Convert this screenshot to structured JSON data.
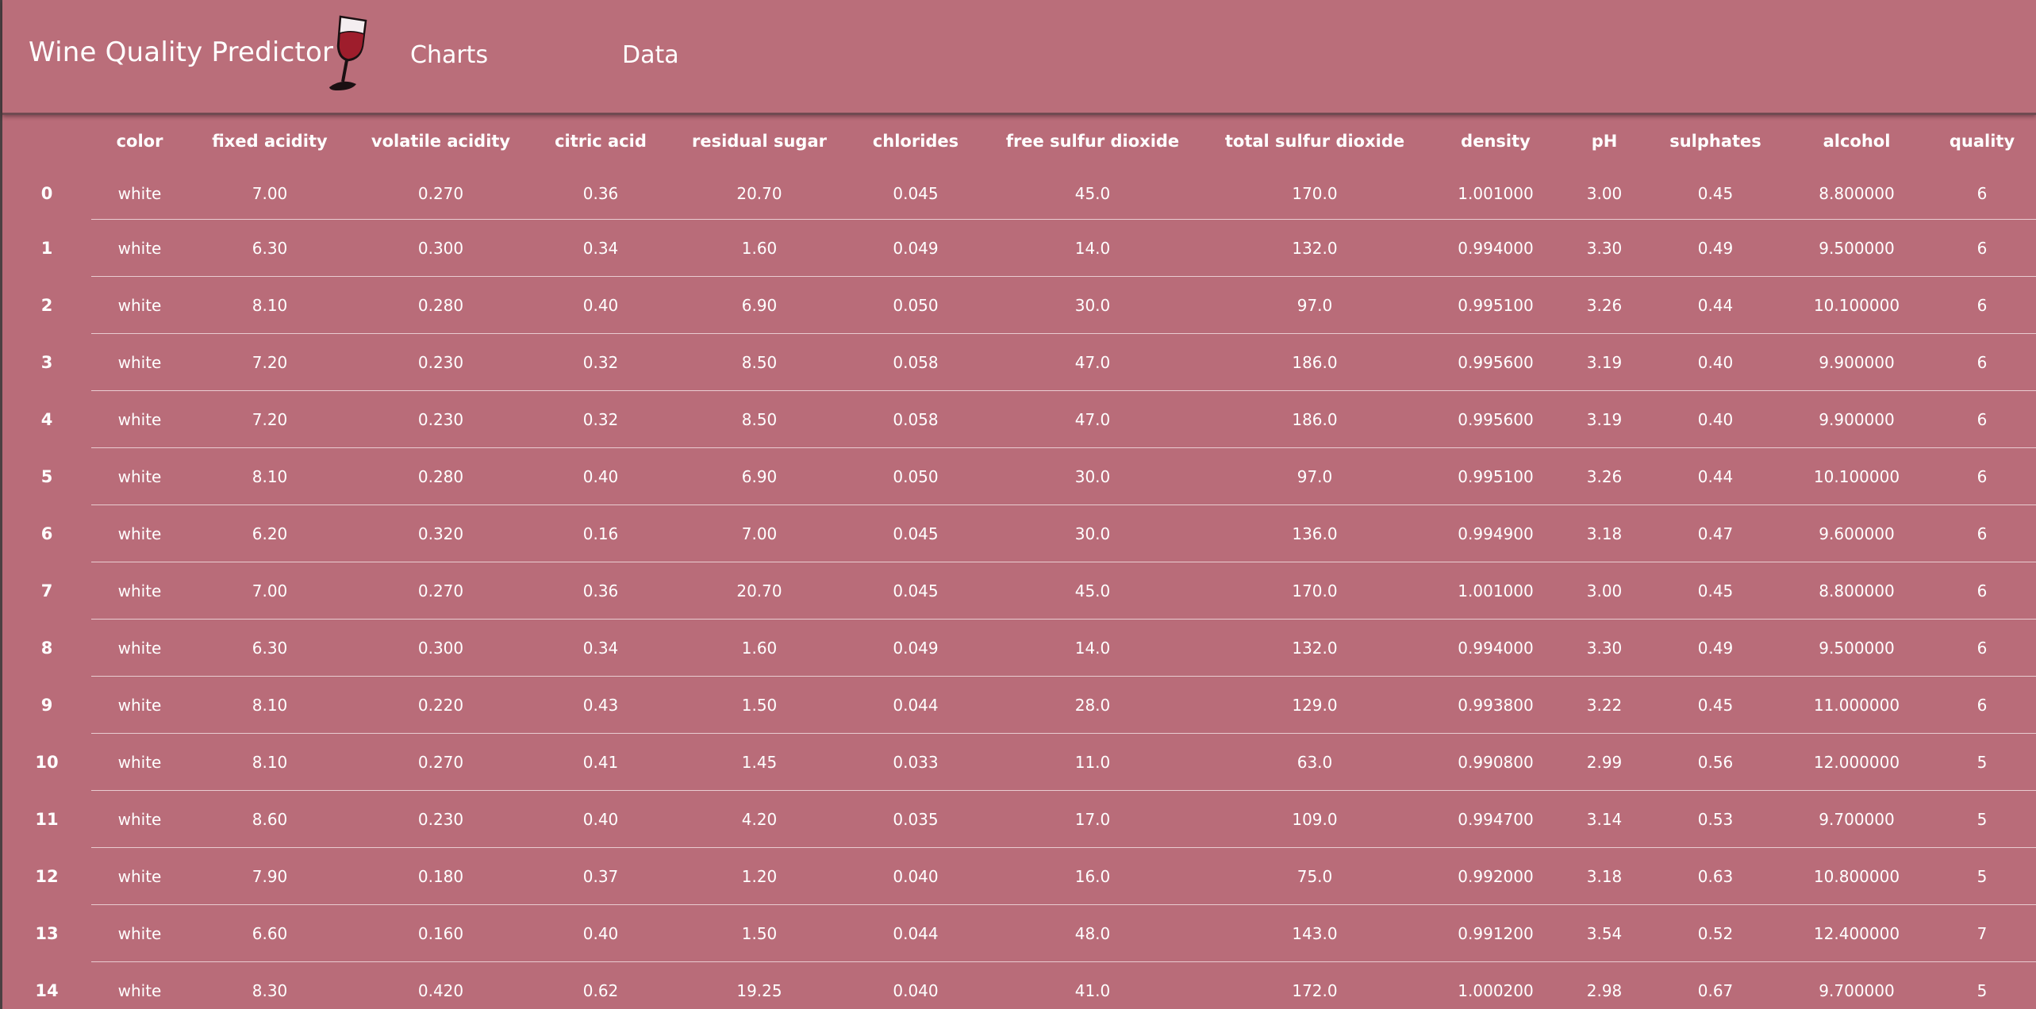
{
  "app": {
    "title": "Wine Quality Predictor",
    "nav": [
      {
        "label": "Charts"
      },
      {
        "label": "Data"
      }
    ],
    "accent_bg": "#b96c79",
    "wine_color": "#9e1d2c"
  },
  "table": {
    "columns": [
      "color",
      "fixed acidity",
      "volatile acidity",
      "citric acid",
      "residual sugar",
      "chlorides",
      "free sulfur dioxide",
      "total sulfur dioxide",
      "density",
      "pH",
      "sulphates",
      "alcohol",
      "quality"
    ],
    "rows": [
      [
        "0",
        "white",
        "7.00",
        "0.270",
        "0.36",
        "20.70",
        "0.045",
        "45.0",
        "170.0",
        "1.001000",
        "3.00",
        "0.45",
        "8.800000",
        "6"
      ],
      [
        "1",
        "white",
        "6.30",
        "0.300",
        "0.34",
        "1.60",
        "0.049",
        "14.0",
        "132.0",
        "0.994000",
        "3.30",
        "0.49",
        "9.500000",
        "6"
      ],
      [
        "2",
        "white",
        "8.10",
        "0.280",
        "0.40",
        "6.90",
        "0.050",
        "30.0",
        "97.0",
        "0.995100",
        "3.26",
        "0.44",
        "10.100000",
        "6"
      ],
      [
        "3",
        "white",
        "7.20",
        "0.230",
        "0.32",
        "8.50",
        "0.058",
        "47.0",
        "186.0",
        "0.995600",
        "3.19",
        "0.40",
        "9.900000",
        "6"
      ],
      [
        "4",
        "white",
        "7.20",
        "0.230",
        "0.32",
        "8.50",
        "0.058",
        "47.0",
        "186.0",
        "0.995600",
        "3.19",
        "0.40",
        "9.900000",
        "6"
      ],
      [
        "5",
        "white",
        "8.10",
        "0.280",
        "0.40",
        "6.90",
        "0.050",
        "30.0",
        "97.0",
        "0.995100",
        "3.26",
        "0.44",
        "10.100000",
        "6"
      ],
      [
        "6",
        "white",
        "6.20",
        "0.320",
        "0.16",
        "7.00",
        "0.045",
        "30.0",
        "136.0",
        "0.994900",
        "3.18",
        "0.47",
        "9.600000",
        "6"
      ],
      [
        "7",
        "white",
        "7.00",
        "0.270",
        "0.36",
        "20.70",
        "0.045",
        "45.0",
        "170.0",
        "1.001000",
        "3.00",
        "0.45",
        "8.800000",
        "6"
      ],
      [
        "8",
        "white",
        "6.30",
        "0.300",
        "0.34",
        "1.60",
        "0.049",
        "14.0",
        "132.0",
        "0.994000",
        "3.30",
        "0.49",
        "9.500000",
        "6"
      ],
      [
        "9",
        "white",
        "8.10",
        "0.220",
        "0.43",
        "1.50",
        "0.044",
        "28.0",
        "129.0",
        "0.993800",
        "3.22",
        "0.45",
        "11.000000",
        "6"
      ],
      [
        "10",
        "white",
        "8.10",
        "0.270",
        "0.41",
        "1.45",
        "0.033",
        "11.0",
        "63.0",
        "0.990800",
        "2.99",
        "0.56",
        "12.000000",
        "5"
      ],
      [
        "11",
        "white",
        "8.60",
        "0.230",
        "0.40",
        "4.20",
        "0.035",
        "17.0",
        "109.0",
        "0.994700",
        "3.14",
        "0.53",
        "9.700000",
        "5"
      ],
      [
        "12",
        "white",
        "7.90",
        "0.180",
        "0.37",
        "1.20",
        "0.040",
        "16.0",
        "75.0",
        "0.992000",
        "3.18",
        "0.63",
        "10.800000",
        "5"
      ],
      [
        "13",
        "white",
        "6.60",
        "0.160",
        "0.40",
        "1.50",
        "0.044",
        "48.0",
        "143.0",
        "0.991200",
        "3.54",
        "0.52",
        "12.400000",
        "7"
      ],
      [
        "14",
        "white",
        "8.30",
        "0.420",
        "0.62",
        "19.25",
        "0.040",
        "41.0",
        "172.0",
        "1.000200",
        "2.98",
        "0.67",
        "9.700000",
        "5"
      ]
    ]
  }
}
